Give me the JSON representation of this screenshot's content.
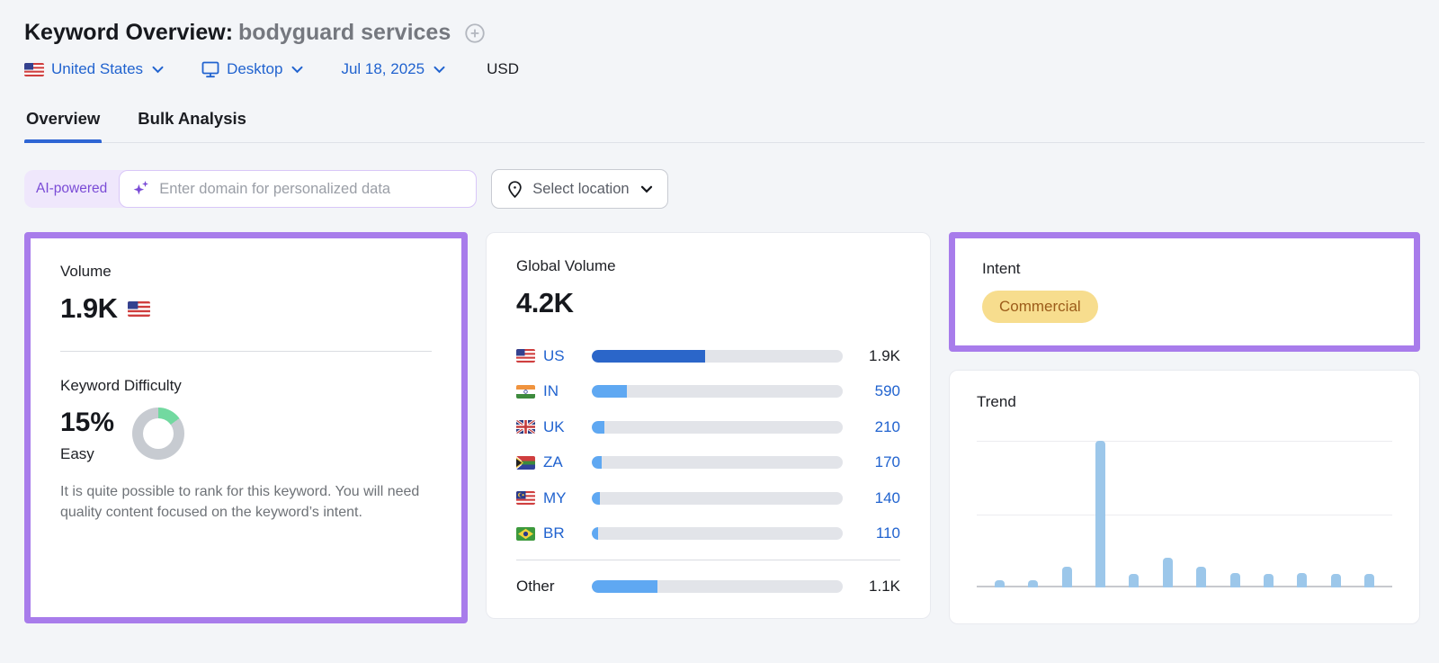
{
  "header": {
    "title": "Keyword Overview:",
    "keyword": "bodyguard services",
    "add_icon": "plus-circle",
    "filters": {
      "location": "United States",
      "device": "Desktop",
      "date": "Jul 18, 2025",
      "currency": "USD"
    }
  },
  "tabs": [
    {
      "label": "Overview",
      "active": true
    },
    {
      "label": "Bulk Analysis",
      "active": false
    }
  ],
  "search": {
    "ai_badge": "AI-powered",
    "placeholder": "Enter domain for personalized data",
    "location_button": "Select location"
  },
  "volume_card": {
    "title": "Volume",
    "value": "1.9K",
    "kd_title": "Keyword Difficulty",
    "kd_value": "15%",
    "kd_percent": 15,
    "kd_label": "Easy",
    "kd_description": "It is quite possible to rank for this keyword. You will need quality content focused on the keyword’s intent."
  },
  "global_volume_card": {
    "title": "Global Volume",
    "value": "4.2K"
  },
  "intent_card": {
    "title": "Intent",
    "badge": "Commercial"
  },
  "trend_card": {
    "title": "Trend"
  },
  "colors": {
    "accent_purple": "#A87CEB",
    "link_blue": "#2163CF",
    "tab_active_blue": "#2E65D4",
    "bar_us_blue": "#2B66C9",
    "bar_light_blue": "#5FA8F2",
    "bar_track_gray": "#E2E4E9",
    "trend_bar_blue": "#9CC7EA",
    "kd_green": "#72D9A0",
    "kd_gray": "#C7CBD1",
    "intent_badge_bg": "#F7DD8E",
    "intent_badge_text": "#9C5C1A",
    "ai_badge_bg": "#EFE7FC",
    "ai_badge_text": "#7A4BD6"
  },
  "chart_data": [
    {
      "type": "bar",
      "orientation": "horizontal",
      "title": "Global Volume",
      "total_label": "4.2K",
      "total_value": 4200,
      "categories": [
        "US",
        "IN",
        "UK",
        "ZA",
        "MY",
        "BR",
        "Other"
      ],
      "values": [
        1900,
        590,
        210,
        170,
        140,
        110,
        1100
      ],
      "value_labels": [
        "1.9K",
        "590",
        "210",
        "170",
        "140",
        "110",
        "1.1K"
      ],
      "rows": [
        {
          "code": "US",
          "flag": "us",
          "value": 1900,
          "label": "1.9K",
          "value_is_link": false,
          "bar_color": "#2B66C9"
        },
        {
          "code": "IN",
          "flag": "in",
          "value": 590,
          "label": "590",
          "value_is_link": true,
          "bar_color": "#5FA8F2"
        },
        {
          "code": "UK",
          "flag": "uk",
          "value": 210,
          "label": "210",
          "value_is_link": true,
          "bar_color": "#5FA8F2"
        },
        {
          "code": "ZA",
          "flag": "za",
          "value": 170,
          "label": "170",
          "value_is_link": true,
          "bar_color": "#5FA8F2"
        },
        {
          "code": "MY",
          "flag": "my",
          "value": 140,
          "label": "140",
          "value_is_link": true,
          "bar_color": "#5FA8F2"
        },
        {
          "code": "BR",
          "flag": "br",
          "value": 110,
          "label": "110",
          "value_is_link": true,
          "bar_color": "#5FA8F2"
        },
        {
          "code": "Other",
          "flag": null,
          "value": 1100,
          "label": "1.1K",
          "value_is_link": false,
          "bar_color": "#5FA8F2",
          "divider_before": true
        }
      ],
      "bar_scale_max": 4200,
      "legend": "none",
      "grid": false
    },
    {
      "type": "bar",
      "orientation": "vertical",
      "title": "Trend",
      "categories": [
        "m1",
        "m2",
        "m3",
        "m4",
        "m5",
        "m6",
        "m7",
        "m8",
        "m9",
        "m10",
        "m11",
        "m12"
      ],
      "values_pct_of_max": [
        5,
        5,
        14,
        100,
        9,
        20,
        14,
        10,
        9,
        10,
        9,
        9
      ],
      "ylim": [
        0,
        100
      ],
      "gridlines_pct": [
        50,
        100
      ],
      "axis_labels": "none",
      "legend": "none"
    }
  ]
}
